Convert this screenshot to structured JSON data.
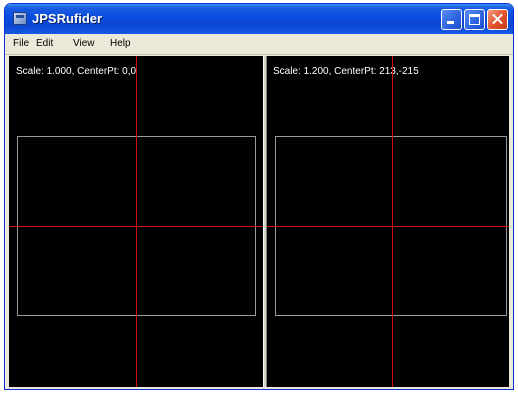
{
  "window": {
    "title": "JPSRufider",
    "icon": "app-window-icon"
  },
  "titlebar_buttons": {
    "minimize": "minimize-icon",
    "maximize": "maximize-icon",
    "close": "close-icon"
  },
  "menu": {
    "file": "File",
    "edit": "Edit",
    "view": "View",
    "help": "Help"
  },
  "views": {
    "left": {
      "info": "Scale: 1.000, CenterPt: 0,0"
    },
    "right": {
      "info": "Scale: 1.200, CenterPt: 213,-215"
    }
  },
  "colors": {
    "titlebar": "#0a4ee0",
    "canvas_background": "#000000",
    "axis_lines": "#d01010",
    "frame_outline": "#9a9a9a",
    "info_text": "#ffffff"
  }
}
